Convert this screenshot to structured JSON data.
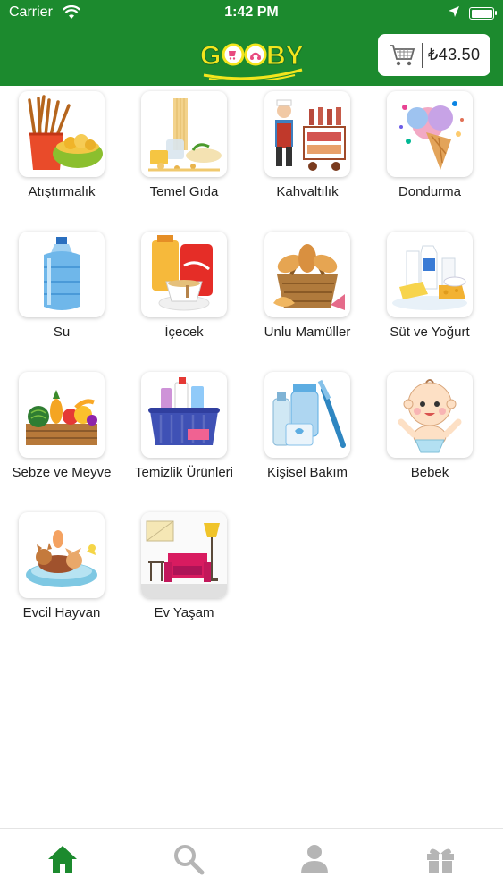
{
  "status_bar": {
    "carrier": "Carrier",
    "time": "1:42 PM"
  },
  "header": {
    "logo_text": "GOOBY",
    "cart_total": "₺43.50",
    "brand_color": "#1c8a2e",
    "cart_icon": "shopping-cart-icon"
  },
  "categories": [
    {
      "label": "Atıştırmalık",
      "icon": "snacks-icon"
    },
    {
      "label": "Temel Gıda",
      "icon": "basic-food-icon"
    },
    {
      "label": "Kahvaltılık",
      "icon": "breakfast-icon"
    },
    {
      "label": "Dondurma",
      "icon": "ice-cream-icon"
    },
    {
      "label": "Su",
      "icon": "water-bottle-icon"
    },
    {
      "label": "İçecek",
      "icon": "beverage-icon"
    },
    {
      "label": "Unlu Mamüller",
      "icon": "bakery-icon"
    },
    {
      "label": "Süt ve Yoğurt",
      "icon": "dairy-icon"
    },
    {
      "label": "Sebze ve Meyve",
      "icon": "produce-icon"
    },
    {
      "label": "Temizlik Ürünleri",
      "icon": "cleaning-icon"
    },
    {
      "label": "Kişisel Bakım",
      "icon": "personal-care-icon"
    },
    {
      "label": "Bebek",
      "icon": "baby-icon"
    },
    {
      "label": "Evcil Hayvan",
      "icon": "pet-icon"
    },
    {
      "label": "Ev Yaşam",
      "icon": "home-living-icon"
    }
  ],
  "tab_bar": {
    "tabs": [
      {
        "icon": "home-icon",
        "active": true
      },
      {
        "icon": "search-icon",
        "active": false
      },
      {
        "icon": "profile-icon",
        "active": false
      },
      {
        "icon": "gift-icon",
        "active": false
      }
    ],
    "active_color": "#1c8a2e",
    "inactive_color": "#b5b5b5"
  }
}
